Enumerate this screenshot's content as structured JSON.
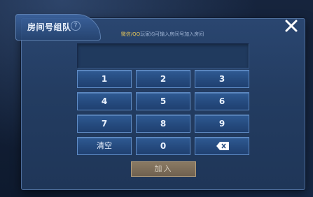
{
  "dialog": {
    "title": "房间号组队",
    "help_icon": "?",
    "hint_highlight": "微信/QQ",
    "hint_text": "玩家均可输入房间号加入房间",
    "input_value": ""
  },
  "keypad": {
    "keys": [
      "1",
      "2",
      "3",
      "4",
      "5",
      "6",
      "7",
      "8",
      "9",
      "清空",
      "0"
    ]
  },
  "actions": {
    "join_label": "加入"
  },
  "colors": {
    "dialog_bg": "#233c61",
    "key_bg": "#2f5a93",
    "hint_highlight": "#e2c45b",
    "join_button": "#7b6d59"
  },
  "icons": {
    "close": "close-icon",
    "backspace": "backspace-icon",
    "help": "help-icon"
  }
}
